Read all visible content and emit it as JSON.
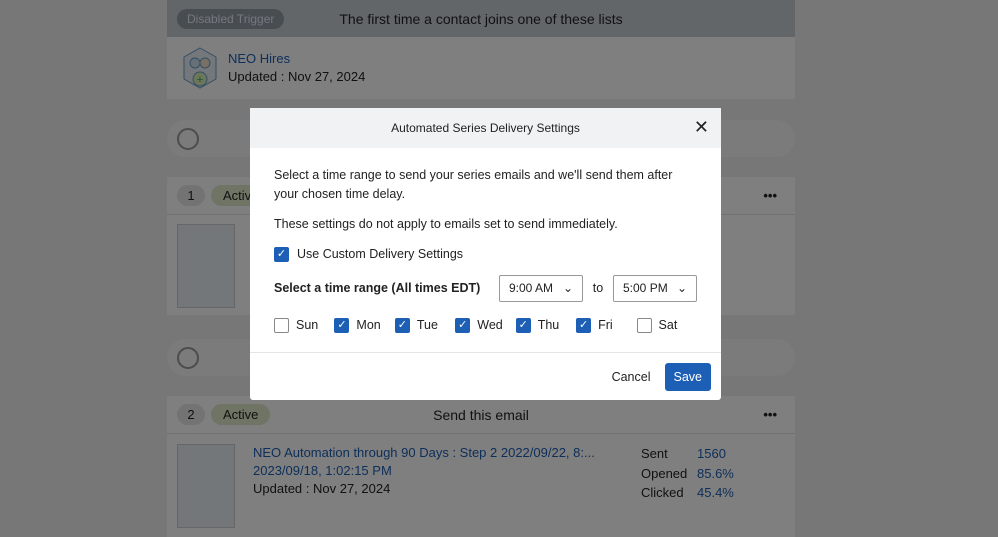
{
  "trigger": {
    "badge": "Disabled Trigger",
    "title": "The first time a contact joins one of these lists"
  },
  "list": {
    "name": "NEO Hires",
    "updated": "Updated : Nov 27, 2024"
  },
  "step1": {
    "num": "1",
    "status": "Active"
  },
  "step2": {
    "num": "2",
    "status": "Active",
    "title": "Send this email",
    "email_name": "NEO Automation through 90 Days : Step 2 2022/09/22, 8:... 2023/09/18, 1:02:15 PM",
    "updated": "Updated : Nov 27, 2024",
    "stats": [
      {
        "label": "Sent",
        "value": "1560"
      },
      {
        "label": "Opened",
        "value": "85.6%"
      },
      {
        "label": "Clicked",
        "value": "45.4%"
      }
    ]
  },
  "modal": {
    "title": "Automated Series Delivery Settings",
    "intro": "Select a time range to send your series emails and we'll send them after your chosen time delay.",
    "note": "These settings do not apply to emails set to send immediately.",
    "custom_label": "Use Custom Delivery Settings",
    "custom_checked": true,
    "range_label": "Select a time range (All times EDT)",
    "from": "9:00 AM",
    "to_label": "to",
    "to": "5:00 PM",
    "days": [
      {
        "label": "Sun",
        "checked": false
      },
      {
        "label": "Mon",
        "checked": true
      },
      {
        "label": "Tue",
        "checked": true
      },
      {
        "label": "Wed",
        "checked": true
      },
      {
        "label": "Thu",
        "checked": true
      },
      {
        "label": "Fri",
        "checked": true
      },
      {
        "label": "Sat",
        "checked": false
      }
    ],
    "cancel": "Cancel",
    "save": "Save"
  },
  "colors": {
    "accent": "#1d5fb4"
  }
}
